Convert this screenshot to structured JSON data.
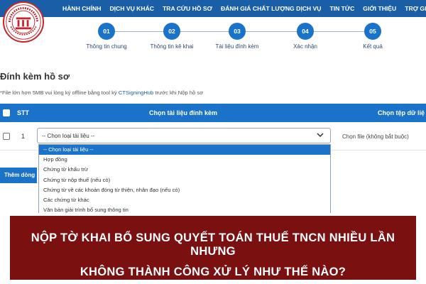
{
  "nav": {
    "items": [
      "HÀNH CHÍNH",
      "DỊCH VỤ KHÁC",
      "TRA CỨU HỒ SƠ",
      "ĐÁNH GIÁ CHẤT LƯỢNG DỊCH VỤ",
      "TIN TỨC",
      "GIỚI THIỆU",
      "TRỢ GIÚP"
    ]
  },
  "logo": {
    "text": "THƯ VIỆN PHÁP LUẬT"
  },
  "steps": [
    {
      "num": "01",
      "label": "Thông tin chung"
    },
    {
      "num": "02",
      "label": "Thông tin kê khai"
    },
    {
      "num": "03",
      "label": "Tài liệu đính kèm"
    },
    {
      "num": "04",
      "label": "Xác nhận"
    },
    {
      "num": "05",
      "label": "Kết quả"
    }
  ],
  "section_title": "Đính kèm hồ sơ",
  "note": {
    "text": "*File lớn hơn 5MB vui lòng ký offline bằng tool ký",
    "link": "CTSigningHub",
    "suffix": "trước khi Nộp hồ sơ"
  },
  "table": {
    "headers": {
      "stt": "STT",
      "choose_doc": "Chọn tài liệu đính kèm",
      "choose_file": "Chọn tệp dữ liệ"
    },
    "row": {
      "stt": "1",
      "select_value": "-- Chọn loại tài liệu --",
      "file_hint": "Chọn file (không bắt buộc)"
    }
  },
  "dropdown": {
    "options": [
      "-- Chọn loại tài liệu --",
      "Hợp đồng",
      "Chứng từ khấu trừ",
      "Chứng từ nộp thuế (nếu có)",
      "Chứng từ về các khoản đóng từ thiện, nhân đạo (nếu có)",
      "Các chứng từ khác",
      "Văn bản giải trình bổ sung thông tin"
    ],
    "selected_index": 0
  },
  "add_row_label": "Thêm dòng",
  "banner": {
    "line1": "NỘP TỜ KHAI BỔ SUNG QUYẾT TOÁN THUẾ TNCN NHIỀU LẦN NHƯNG",
    "line2": "KHÔNG THÀNH CÔNG XỬ LÝ NHƯ THẾ NÀO?"
  },
  "colors": {
    "primary": "#1a73c9",
    "nav": "#1a5ea8",
    "banner": "#7a1010",
    "logo_red": "#c6262b"
  }
}
